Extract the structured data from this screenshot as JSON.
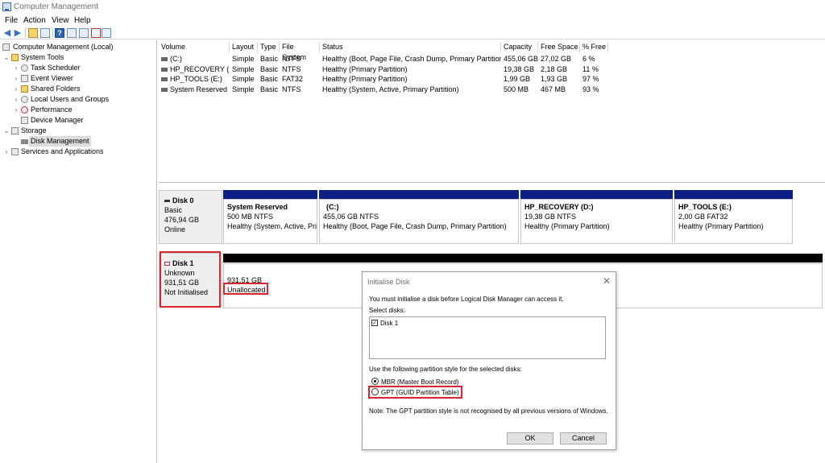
{
  "window": {
    "title": "Computer Management"
  },
  "menu": [
    "File",
    "Action",
    "View",
    "Help"
  ],
  "tree": {
    "root": "Computer Management (Local)",
    "system_tools": "System Tools",
    "task_scheduler": "Task Scheduler",
    "event_viewer": "Event Viewer",
    "shared_folders": "Shared Folders",
    "local_users": "Local Users and Groups",
    "performance": "Performance",
    "device_manager": "Device Manager",
    "storage": "Storage",
    "disk_management": "Disk Management",
    "services": "Services and Applications"
  },
  "volume_table": {
    "headers": [
      "Volume",
      "Layout",
      "Type",
      "File System",
      "Status",
      "Capacity",
      "Free Space",
      "% Free"
    ],
    "rows": [
      [
        "(C:)",
        "Simple",
        "Basic",
        "NTFS",
        "Healthy (Boot, Page File, Crash Dump, Primary Partition)",
        "455,06 GB",
        "27,02 GB",
        "6 %"
      ],
      [
        "HP_RECOVERY (D:)",
        "Simple",
        "Basic",
        "NTFS",
        "Healthy (Primary Partition)",
        "19,38 GB",
        "2,18 GB",
        "11 %"
      ],
      [
        "HP_TOOLS (E:)",
        "Simple",
        "Basic",
        "FAT32",
        "Healthy (Primary Partition)",
        "1,99 GB",
        "1,93 GB",
        "97 %"
      ],
      [
        "System Reserved",
        "Simple",
        "Basic",
        "NTFS",
        "Healthy (System, Active, Primary Partition)",
        "500 MB",
        "467 MB",
        "93 %"
      ]
    ]
  },
  "disk0": {
    "name": "Disk 0",
    "type": "Basic",
    "size": "476,94 GB",
    "state": "Online",
    "partitions": [
      {
        "title": "System Reserved",
        "size": "500 MB NTFS",
        "status": "Healthy (System, Active, Prir"
      },
      {
        "title": "(C:)",
        "size": "455,06 GB NTFS",
        "status": "Healthy (Boot, Page File, Crash Dump, Primary Partition)"
      },
      {
        "title": "HP_RECOVERY  (D:)",
        "size": "19,38 GB NTFS",
        "status": "Healthy (Primary Partition)"
      },
      {
        "title": "HP_TOOLS  (E:)",
        "size": "2,00 GB FAT32",
        "status": "Healthy (Primary Partition)"
      }
    ]
  },
  "disk1": {
    "name": "Disk 1",
    "type": "Unknown",
    "size": "931,51 GB",
    "state": "Not Initialised",
    "unallocated_size": "931,51 GB",
    "unallocated_label": "Unallocated"
  },
  "dialog": {
    "title": "Initialise Disk",
    "message": "You must initialise a disk before Logical Disk Manager can access it.",
    "select_label": "Select disks:",
    "disk_item": "Disk 1",
    "style_label": "Use the following partition style for the selected disks:",
    "mbr": "MBR (Master Boot Record)",
    "gpt": "GPT (GUID Partition Table)",
    "note": "Note: The GPT partition style is not recognised by all previous versions of Windows.",
    "ok": "OK",
    "cancel": "Cancel"
  },
  "colors": {
    "partition_bar": "#0d1e84",
    "unallocated_bar": "#000000",
    "highlight": "#d6262f"
  }
}
